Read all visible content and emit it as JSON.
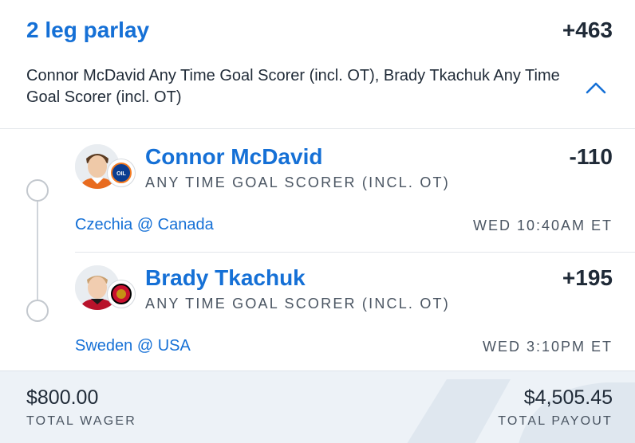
{
  "parlay": {
    "title": "2 leg parlay",
    "odds": "+463",
    "summary": "Connor McDavid Any Time Goal Scorer (incl. OT), Brady Tkachuk Any Time Goal Scorer (incl. OT)"
  },
  "legs": [
    {
      "player": "Connor McDavid",
      "market": "ANY TIME GOAL SCORER (INCL. OT)",
      "odds": "-110",
      "matchup": "Czechia @ Canada",
      "time": "WED 10:40AM ET",
      "team_logo": "oilers-logo",
      "team_color": "#0b3d91"
    },
    {
      "player": "Brady Tkachuk",
      "market": "ANY TIME GOAL SCORER (INCL. OT)",
      "odds": "+195",
      "matchup": "Sweden @ USA",
      "time": "WED 3:10PM ET",
      "team_logo": "senators-logo",
      "team_color": "#c8102e"
    }
  ],
  "footer": {
    "wager_amount": "$800.00",
    "wager_label": "TOTAL WAGER",
    "payout_amount": "$4,505.45",
    "payout_label": "TOTAL PAYOUT"
  },
  "colors": {
    "accent": "#1570d6",
    "text": "#1f2a37",
    "muted": "#4a5562",
    "footer_bg": "#edf2f7"
  }
}
